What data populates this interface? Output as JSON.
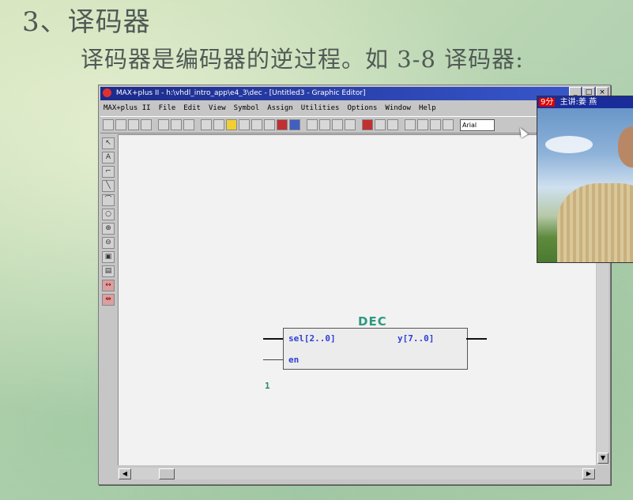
{
  "slide": {
    "heading": "3、译码器",
    "text": "译码器是编码器的逆过程。如 3-8 译码器:"
  },
  "window": {
    "title": "MAX+plus II - h:\\vhdl_intro_app\\e4_3\\dec - [Untitled3 - Graphic Editor]",
    "buttons": {
      "minimize": "_",
      "maximize": "□",
      "close": "×"
    }
  },
  "menu": {
    "items": [
      "MAX+plus II",
      "File",
      "Edit",
      "View",
      "Symbol",
      "Assign",
      "Utilities",
      "Options",
      "Window",
      "Help"
    ]
  },
  "toolbar": {
    "font_value": "Arial"
  },
  "symbol": {
    "name": "DEC",
    "input_sel": "sel[2..0]",
    "input_en": "en",
    "output_y": "y[7..0]",
    "instance_number": "1"
  },
  "video": {
    "time_label": "9分",
    "speaker_label": "主讲:姜 燕"
  },
  "colors": {
    "title_bar": "#1b2a8a",
    "symbol_name": "#2b9a80",
    "port_text": "#2d3fd8"
  }
}
